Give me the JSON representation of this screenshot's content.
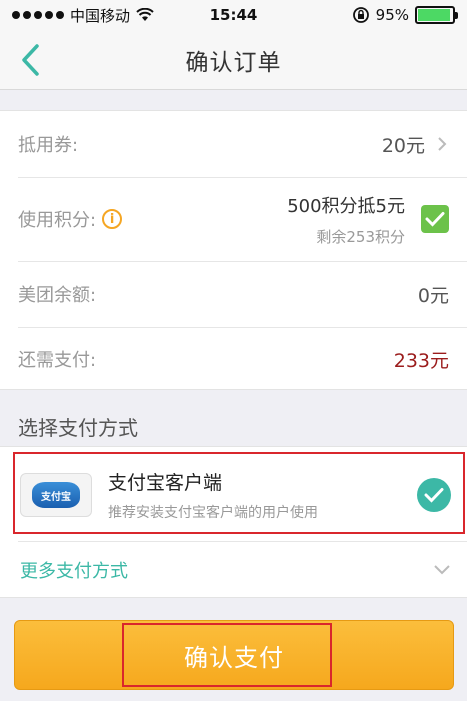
{
  "status_bar": {
    "carrier": "中国移动",
    "time": "15:44",
    "battery_percent": "95%",
    "battery_level": 0.95
  },
  "nav": {
    "title": "确认订单",
    "back_icon": "chevron-left-icon"
  },
  "order": {
    "coupon": {
      "label": "抵用券:",
      "value": "20元"
    },
    "points": {
      "label": "使用积分:",
      "offer": "500积分抵5元",
      "remaining": "剩余253积分",
      "checked": true
    },
    "balance": {
      "label": "美团余额:",
      "value": "0元"
    },
    "due": {
      "label": "还需支付:",
      "value": "233元"
    }
  },
  "payment": {
    "section_title": "选择支付方式",
    "selected": {
      "logo_text": "支付宝",
      "name": "支付宝客户端",
      "description": "推荐安装支付宝客户端的用户使用"
    },
    "more_label": "更多支付方式"
  },
  "confirm_button": {
    "label": "确认支付"
  },
  "colors": {
    "accent": "#3cb8a6",
    "button": "#f6a81d",
    "due_amount": "#9b1c1c",
    "highlight": "#d9262c"
  }
}
